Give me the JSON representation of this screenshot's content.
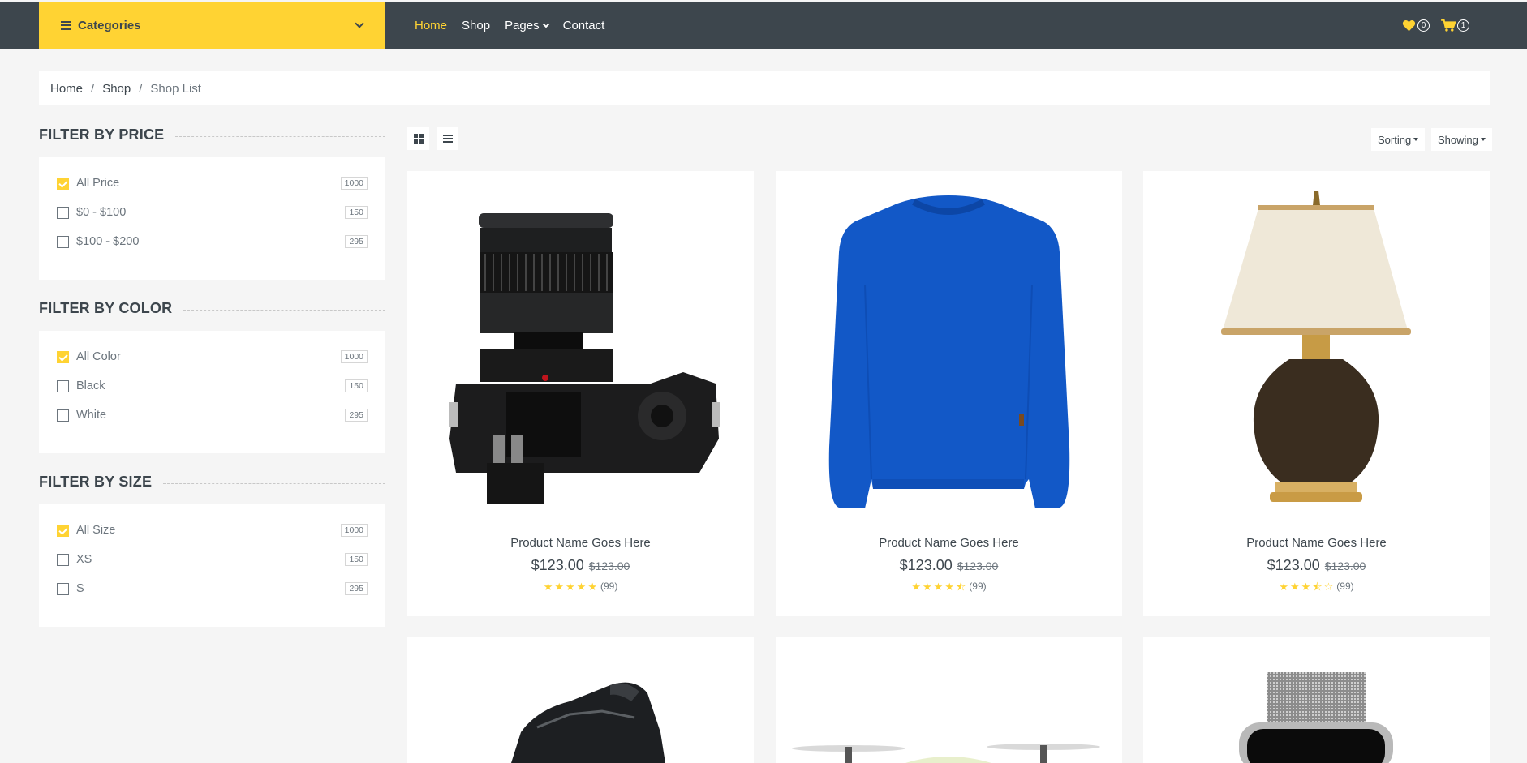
{
  "topbar": {
    "categories_label": "Categories",
    "nav": [
      {
        "label": "Home",
        "active": true
      },
      {
        "label": "Shop",
        "active": false
      },
      {
        "label": "Pages",
        "active": false,
        "dropdown": true
      },
      {
        "label": "Contact",
        "active": false
      }
    ],
    "wishlist_count": "0",
    "cart_count": "1"
  },
  "breadcrumb": {
    "items": [
      "Home",
      "Shop",
      "Shop List"
    ]
  },
  "filters": {
    "price": {
      "title": "FILTER BY PRICE",
      "options": [
        {
          "label": "All Price",
          "count": "1000",
          "checked": true
        },
        {
          "label": "$0 - $100",
          "count": "150",
          "checked": false
        },
        {
          "label": "$100 - $200",
          "count": "295",
          "checked": false
        }
      ]
    },
    "color": {
      "title": "FILTER BY COLOR",
      "options": [
        {
          "label": "All Color",
          "count": "1000",
          "checked": true
        },
        {
          "label": "Black",
          "count": "150",
          "checked": false
        },
        {
          "label": "White",
          "count": "295",
          "checked": false
        }
      ]
    },
    "size": {
      "title": "FILTER BY SIZE",
      "options": [
        {
          "label": "All Size",
          "count": "1000",
          "checked": true
        },
        {
          "label": "XS",
          "count": "150",
          "checked": false
        },
        {
          "label": "S",
          "count": "295",
          "checked": false
        }
      ]
    }
  },
  "toolbar": {
    "sorting_label": "Sorting",
    "showing_label": "Showing"
  },
  "products": [
    {
      "name": "Product Name Goes Here",
      "price": "$123.00",
      "old_price": "$123.00",
      "stars": 5,
      "reviews": "(99)",
      "image": "camera"
    },
    {
      "name": "Product Name Goes Here",
      "price": "$123.00",
      "old_price": "$123.00",
      "stars": 4.5,
      "reviews": "(99)",
      "image": "sweater"
    },
    {
      "name": "Product Name Goes Here",
      "price": "$123.00",
      "old_price": "$123.00",
      "stars": 3.5,
      "reviews": "(99)",
      "image": "lamp"
    },
    {
      "image": "shoe"
    },
    {
      "image": "drone"
    },
    {
      "image": "watch"
    }
  ],
  "colors": {
    "accent": "#ffd333",
    "dark": "#3d464d",
    "muted": "#6c757d",
    "background": "#f5f5f5"
  }
}
